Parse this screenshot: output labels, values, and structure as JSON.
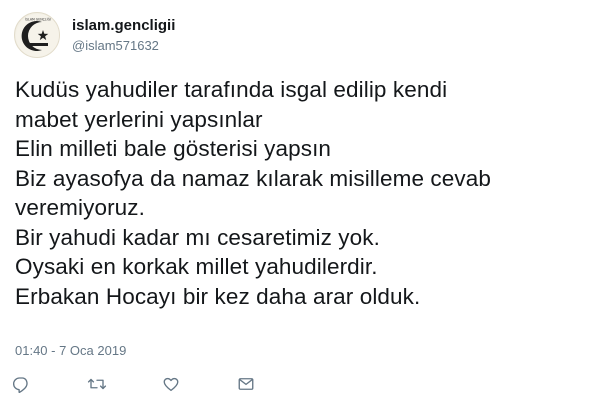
{
  "user": {
    "display_name": "islam.gencligii",
    "handle": "@islam571632",
    "avatar_icon": "crescent-star-logo-icon",
    "avatar_logo_text": "İSLAM GENÇLİĞİ"
  },
  "tweet": {
    "lines": [
      "Kudüs yahudiler tarafında isgal edilip kendi",
      "mabet yerlerini yapsınlar",
      "Elin milleti bale gösterisi yapsın",
      "Biz ayasofya da namaz kılarak misilleme cevab",
      "veremiyoruz.",
      "Bir yahudi kadar mı cesaretimiz yok.",
      "Oysaki en korkak millet yahudilerdir.",
      "Erbakan Hocayı bir kez daha arar olduk."
    ],
    "timestamp": "01:40 - 7 Oca 2019"
  },
  "actions": [
    {
      "name": "reply",
      "icon": "reply-icon"
    },
    {
      "name": "retweet",
      "icon": "retweet-icon"
    },
    {
      "name": "like",
      "icon": "heart-icon"
    },
    {
      "name": "message",
      "icon": "envelope-icon"
    }
  ],
  "colors": {
    "text": "#14171a",
    "secondary": "#657786",
    "icon": "#657786"
  }
}
